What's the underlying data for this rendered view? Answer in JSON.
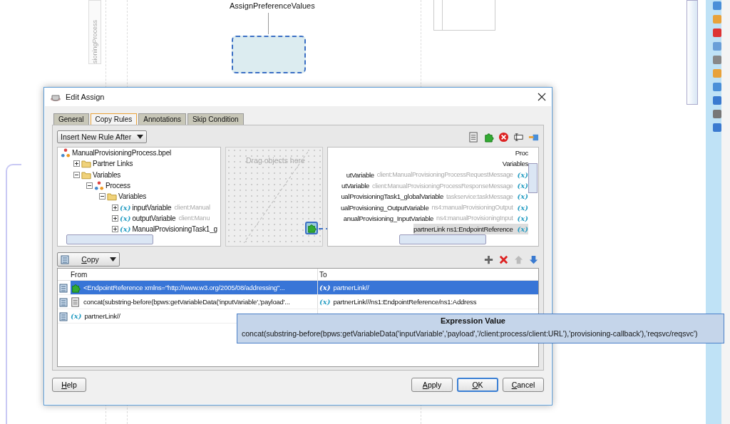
{
  "canvas": {
    "lane_label": "sioningProcess",
    "activity": {
      "name": "AssignPreferenceValues",
      "selected": true
    }
  },
  "dialog": {
    "title": "Edit Assign",
    "tabs": [
      {
        "label": "General",
        "selected": false
      },
      {
        "label": "Copy Rules",
        "selected": true
      },
      {
        "label": "Annotations",
        "selected": false
      },
      {
        "label": "Skip Condition",
        "selected": false
      }
    ],
    "rule_position": "Insert New Rule After",
    "source_tree": [
      {
        "label": "ManualProvisioningProcess.bpel",
        "kind": "process",
        "children": [
          {
            "label": "Partner Links",
            "kind": "folder",
            "expanded": false
          },
          {
            "label": "Variables",
            "kind": "folder",
            "expanded": true,
            "children": [
              {
                "label": "Process",
                "kind": "process",
                "expanded": true,
                "children": [
                  {
                    "label": "Variables",
                    "kind": "folder",
                    "expanded": true,
                    "children": [
                      {
                        "label": "inputVariable",
                        "type": "client:Manual",
                        "kind": "variable",
                        "icon": "(x)",
                        "expanded": false
                      },
                      {
                        "label": "outputVariable",
                        "type": "client:Manu",
                        "kind": "variable",
                        "icon": "(x)",
                        "expanded": false
                      },
                      {
                        "label": "ManualProvisioningTask1_g",
                        "kind": "variable",
                        "icon": "(x)",
                        "expanded": false
                      }
                    ]
                  }
                ]
              }
            ]
          }
        ]
      }
    ],
    "drop_hint": "Drag objects here",
    "target_tree": [
      {
        "label": "Proc",
        "selected": false
      },
      {
        "label": "Variables",
        "selected": false
      },
      {
        "label": "utVariable",
        "type": "client:ManualProvisioningProcessRequestMessage",
        "icon": "(x)",
        "selected": false
      },
      {
        "label": "utVariable",
        "type": "client:ManualProvisioningProcessResponseMessage",
        "icon": "(x)",
        "selected": false
      },
      {
        "label": "ualProvisioningTask1_globalVariable",
        "type": "taskservice:taskMessage",
        "icon": "(x)",
        "selected": false
      },
      {
        "label": "ualProvisioning_OutputVariable",
        "type": "ns4:manualProvisioningOutput",
        "icon": "(x)",
        "selected": false
      },
      {
        "label": "anualProvisioning_InputVariable",
        "type": "ns4:manualProvisioningInput",
        "icon": "(x)",
        "selected": false
      },
      {
        "label": "partnerLink ns1:EndpointReference",
        "icon": "(x)",
        "selected": true
      }
    ],
    "operation": "Copy",
    "table": {
      "columns": [
        "From",
        "To"
      ],
      "rows": [
        {
          "from": {
            "kind": "literal",
            "text": "<EndpointReference xmlns=\"http://www.w3.org/2005/08/addressing\"..."
          },
          "to": {
            "kind": "variable",
            "icon": "(x)",
            "text": "partnerLink//"
          },
          "selected": true
        },
        {
          "from": {
            "kind": "expression",
            "text": "concat(substring-before(bpws:getVariableData('inputVariable','payload'..."
          },
          "to": {
            "kind": "variable",
            "icon": "(x)",
            "text": "partnerLink///ns1:EndpointReference/ns1:Address"
          },
          "selected": false
        },
        {
          "from": {
            "kind": "variable",
            "icon": "(x)",
            "text": "partnerLink//"
          },
          "selected": false
        }
      ]
    },
    "tooltip": {
      "title": "Expression Value",
      "text": "concat(substring-before(bpws:getVariableData('inputVariable','payload','/client:process/client:URL'),'provisioning-callback'),'reqsvc/reqsvc')"
    },
    "buttons": [
      {
        "label": "Help",
        "default": false
      },
      {
        "label": "Apply",
        "default": false
      },
      {
        "label": "OK",
        "default": true
      },
      {
        "label": "Cancel",
        "default": false
      }
    ]
  }
}
